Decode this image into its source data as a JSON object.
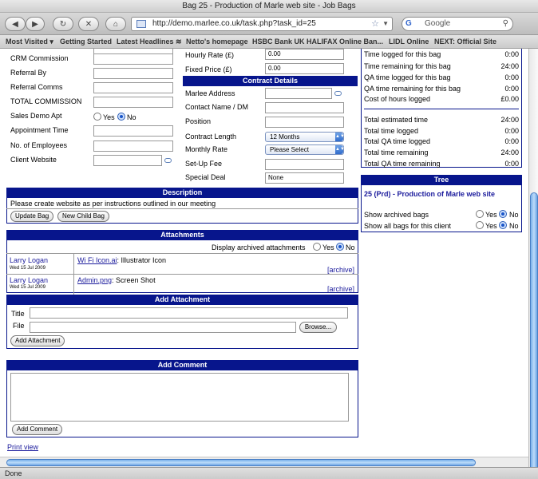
{
  "window": {
    "title": "Bag 25 - Production of Marle web site - Job Bags"
  },
  "toolbar": {
    "url": "http://demo.marlee.co.uk/task.php?task_id=25",
    "search_placeholder": "Google"
  },
  "bookmarks": [
    "Most Visited ▾",
    "Getting Started",
    "Latest Headlines ≋",
    "Netto's homepage",
    "HSBC Bank UK",
    "HALIFAX Online Ban...",
    "LIDL Online",
    "NEXT: Official Site"
  ],
  "left_form": {
    "crm_commission": "CRM Commission",
    "referral_by": "Referral By",
    "referral_comms": "Referral Comms",
    "total_commission": "TOTAL COMMISSION",
    "sales_demo": "Sales Demo Apt",
    "yes": "Yes",
    "no": "No",
    "appointment_time": "Appointment Time",
    "employees": "No. of Employees",
    "client_website": "Client Website"
  },
  "mid_form": {
    "hourly_rate": "Hourly Rate (£)",
    "hourly_rate_value": "0.00",
    "fixed_price": "Fixed Price (£)",
    "fixed_price_value": "0.00",
    "contract_header": "Contract Details",
    "marlee_address": "Marlee Address",
    "contact_name": "Contact Name / DM",
    "position": "Position",
    "contract_length": "Contract Length",
    "contract_length_value": "12 Months",
    "monthly_rate": "Monthly Rate",
    "monthly_rate_value": "Please Select",
    "setup_fee": "Set-Up Fee",
    "special_deal": "Special Deal",
    "special_deal_value": "None"
  },
  "time_stats": {
    "rows": [
      {
        "label": "Time logged for this bag",
        "value": "0:00"
      },
      {
        "label": "Time remaining for this bag",
        "value": "24:00"
      },
      {
        "label": "QA time logged for this bag",
        "value": "0:00"
      },
      {
        "label": "QA time remaining for this bag",
        "value": "0:00"
      },
      {
        "label": "Cost of hours logged",
        "value": "£0.00"
      }
    ],
    "totals": [
      {
        "label": "Total estimated time",
        "value": "24:00"
      },
      {
        "label": "Total time logged",
        "value": "0:00"
      },
      {
        "label": "Total QA time logged",
        "value": "0:00"
      },
      {
        "label": "Total time remaining",
        "value": "24:00"
      },
      {
        "label": "Total QA time remaining",
        "value": "0:00"
      }
    ]
  },
  "tree": {
    "header": "Tree",
    "item": "25 (Prd) - Production of Marle web site",
    "show_archived": "Show archived bags",
    "show_all": "Show all bags for this client",
    "yes": "Yes",
    "no": "No"
  },
  "description": {
    "header": "Description",
    "text": "Please create website as per instructions outlined in our meeting",
    "update_button": "Update Bag",
    "child_button": "New Child Bag"
  },
  "attachments": {
    "header": "Attachments",
    "display_archived": "Display archived attachments",
    "yes": "Yes",
    "no": "No",
    "items": [
      {
        "user": "Larry Logan",
        "date": "Wed 15 Jul 2009",
        "file": "Wi Fi Icon.ai",
        "desc": ": Illustrator Icon",
        "action": "[archive]"
      },
      {
        "user": "Larry Logan",
        "date": "Wed 15 Jul 2009",
        "file": "Admin.png",
        "desc": ": Screen Shot",
        "action": "[archive]"
      }
    ]
  },
  "add_attachment": {
    "header": "Add Attachment",
    "title_label": "Title",
    "file_label": "File",
    "browse": "Browse...",
    "button": "Add Attachment"
  },
  "add_comment": {
    "header": "Add Comment",
    "button": "Add Comment"
  },
  "footer": {
    "print_view": "Print view"
  },
  "status": {
    "text": "Done"
  }
}
